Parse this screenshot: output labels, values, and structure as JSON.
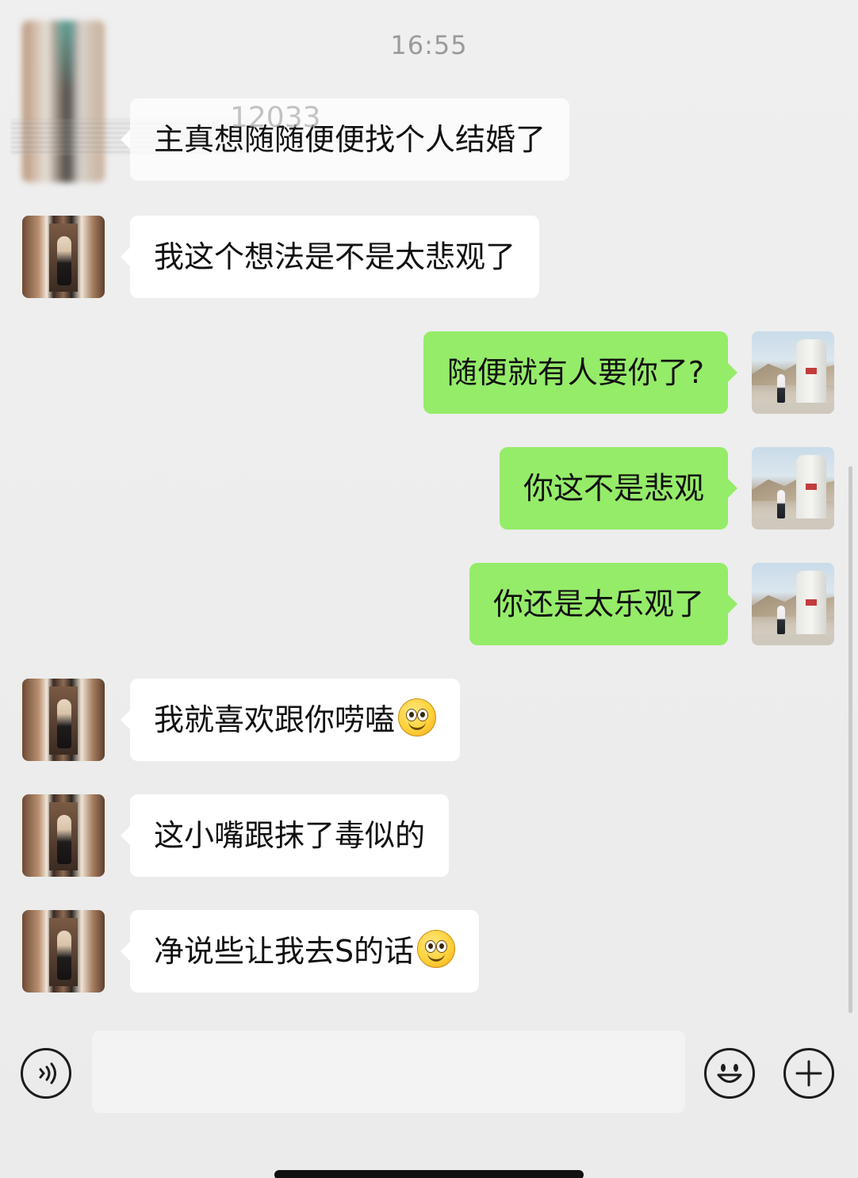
{
  "timestamp": "16:55",
  "ghost_text": "12033",
  "messages": [
    {
      "side": "in",
      "text": "主真想随随便便找个人结婚了",
      "emoji": false
    },
    {
      "side": "in",
      "text": "我这个想法是不是太悲观了",
      "emoji": false
    },
    {
      "side": "out",
      "text": "随便就有人要你了?",
      "emoji": false
    },
    {
      "side": "out",
      "text": "你这不是悲观",
      "emoji": false
    },
    {
      "side": "out",
      "text": "你还是太乐观了",
      "emoji": false
    },
    {
      "side": "in",
      "text": "我就喜欢跟你唠嗑",
      "emoji": true
    },
    {
      "side": "in",
      "text": "这小嘴跟抹了毒似的",
      "emoji": false
    },
    {
      "side": "in",
      "text": "净说些让我去S的话",
      "emoji": true
    }
  ],
  "input": {
    "placeholder": "",
    "voice_icon": "voice-icon",
    "emoji_icon": "emoji-icon",
    "plus_icon": "plus-icon"
  },
  "colors": {
    "background": "#ededed",
    "incoming_bubble": "#ffffff",
    "outgoing_bubble": "#95ec69",
    "timestamp": "#9a9a9a"
  }
}
